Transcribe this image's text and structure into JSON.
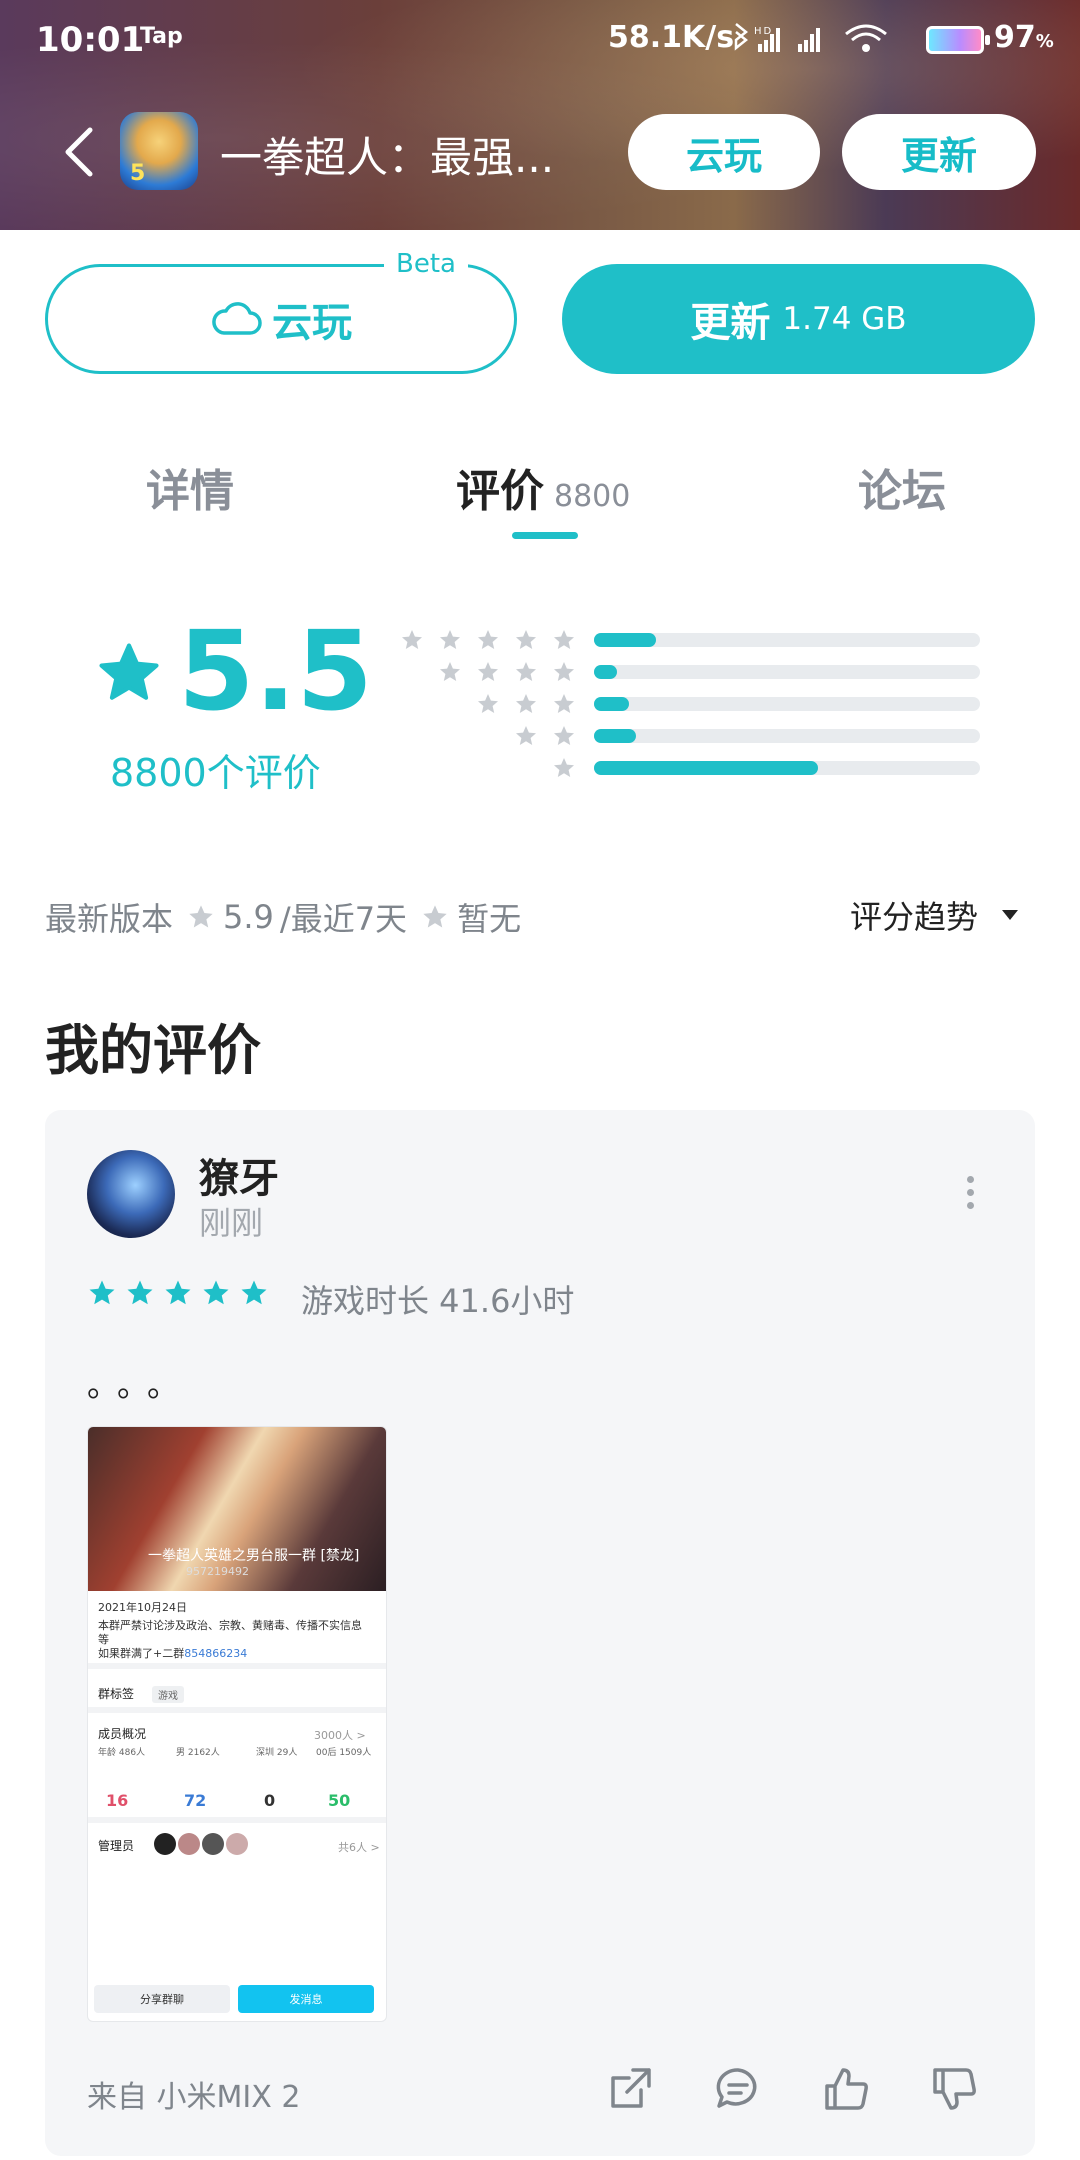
{
  "status_bar": {
    "time": "10:01",
    "app": "Tap",
    "speed": "58.1K/s",
    "battery": "97",
    "battery_unit": "%"
  },
  "header": {
    "title": "一拳超人：最强...",
    "cloud_play": "云玩",
    "update": "更新",
    "icon_badge": "5周年"
  },
  "actions": {
    "beta": "Beta",
    "cloud_play": "云玩",
    "update": "更新",
    "size": "1.74 GB"
  },
  "tabs": [
    {
      "label": "详情"
    },
    {
      "label": "评价",
      "count": "8800"
    },
    {
      "label": "论坛"
    }
  ],
  "rating": {
    "score": "5.5",
    "count_text": "8800个评价",
    "distribution": [
      {
        "stars": 5,
        "fraction": 0.16
      },
      {
        "stars": 4,
        "fraction": 0.06
      },
      {
        "stars": 3,
        "fraction": 0.09
      },
      {
        "stars": 2,
        "fraction": 0.11
      },
      {
        "stars": 1,
        "fraction": 0.58
      }
    ]
  },
  "version_row": {
    "label": "最新版本",
    "latest": "5.9",
    "recent_label": "/最近7天",
    "recent": "暂无",
    "trend": "评分趋势"
  },
  "my_review": {
    "section_title": "我的评价",
    "user": "獠牙",
    "time": "刚刚",
    "stars": 5,
    "playtime": "游戏时长 41.6小时",
    "content": "。。。",
    "device": "来自 小米MIX 2",
    "screenshot": {
      "title": "一拳超人英雄之男台服一群 [禁龙]",
      "id": "957219492",
      "date": "2021年10月24日",
      "notice1": "本群严禁讨论涉及政治、宗教、黄赌毒、传播不实信息",
      "notice2": "等",
      "notice3": "如果群满了+二群",
      "group2": "854866234",
      "tags_label": "群标签",
      "tag": "游戏",
      "members_label": "成员概况",
      "members_total": "3000人 >",
      "stat_labels": [
        "年龄 486人",
        "男 2162人",
        "深圳 29人",
        "00后 1509人"
      ],
      "stat_values": [
        "16",
        "72",
        "0",
        "50"
      ],
      "admins_label": "管理员",
      "admins_count": "共6人 >",
      "share_btn": "分享群聊",
      "send_btn": "发消息"
    }
  },
  "colors": {
    "accent": "#1fbfc8",
    "gray": "#7f858c"
  }
}
